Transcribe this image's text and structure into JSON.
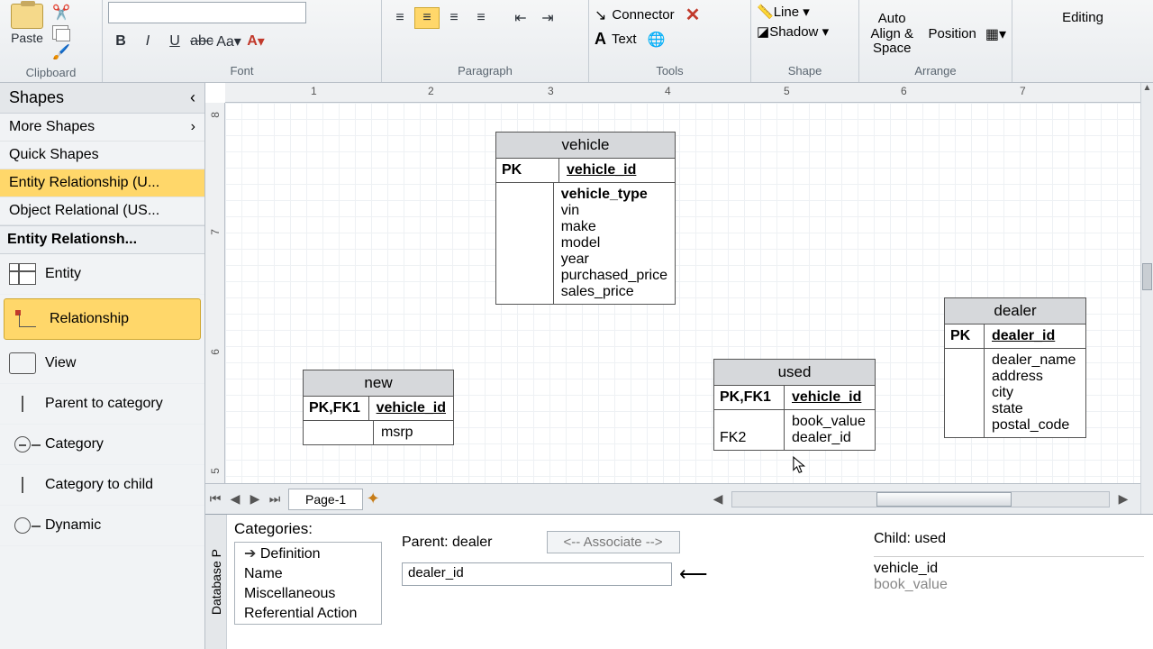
{
  "ribbon": {
    "clipboard": {
      "paste": "Paste",
      "label": "Clipboard"
    },
    "font": {
      "label": "Font"
    },
    "paragraph": {
      "label": "Paragraph"
    },
    "tools": {
      "connector": "Connector",
      "text": "Text",
      "label": "Tools"
    },
    "shape": {
      "line": "Line",
      "shadow": "Shadow",
      "label": "Shape"
    },
    "arrange": {
      "autoalign": "Auto Align & Space",
      "position": "Position",
      "label": "Arrange"
    },
    "editing": {
      "label": "Editing"
    }
  },
  "shapes_panel": {
    "header": "Shapes",
    "more": "More Shapes",
    "quick": "Quick Shapes",
    "stencil_er": "Entity Relationship (U...",
    "stencil_or": "Object Relational (US...",
    "section": "Entity Relationsh...",
    "items": {
      "entity": "Entity",
      "relationship": "Relationship",
      "view": "View",
      "parent_to_cat": "Parent to category",
      "category": "Category",
      "cat_to_child": "Category to child",
      "dynamic": "Dynamic"
    }
  },
  "ruler_h": [
    "1",
    "2",
    "3",
    "4",
    "5",
    "6",
    "7"
  ],
  "ruler_v": [
    "8",
    "7",
    "6",
    "5"
  ],
  "entities": {
    "vehicle": {
      "title": "vehicle",
      "pk_label": "PK",
      "pk": "vehicle_id",
      "attrs": [
        "vehicle_type",
        "vin",
        "make",
        "model",
        "year",
        "purchased_price",
        "sales_price"
      ]
    },
    "new": {
      "title": "new",
      "pk_label": "PK,FK1",
      "pk": "vehicle_id",
      "attr": "msrp"
    },
    "used": {
      "title": "used",
      "pk_label": "PK,FK1",
      "pk": "vehicle_id",
      "fk_label": "FK2",
      "attrs": [
        "book_value",
        "dealer_id"
      ]
    },
    "dealer": {
      "title": "dealer",
      "pk_label": "PK",
      "pk": "dealer_id",
      "attrs": [
        "dealer_name",
        "address",
        "city",
        "state",
        "postal_code"
      ]
    }
  },
  "page_tab": "Page-1",
  "dbpanel": {
    "vlabel": "Database P",
    "categories_label": "Categories:",
    "categories": [
      "Definition",
      "Name",
      "Miscellaneous",
      "Referential Action"
    ],
    "parent_label": "Parent: dealer",
    "associate": "<-- Associate -->",
    "child_label": "Child: used",
    "parent_field": "dealer_id",
    "child_fields": [
      "vehicle_id",
      "book_value"
    ]
  }
}
